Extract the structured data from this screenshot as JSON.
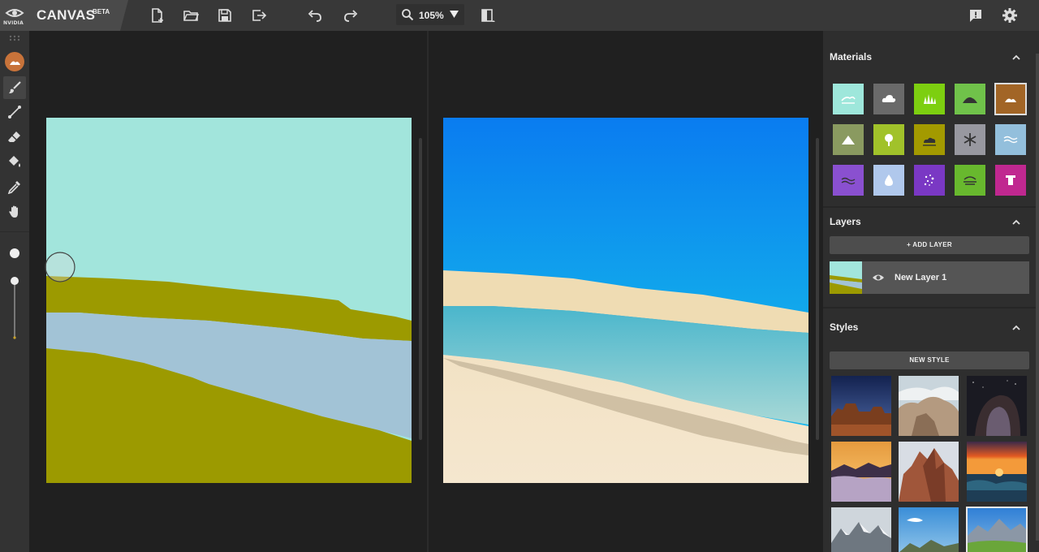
{
  "app": {
    "logo_word": "NVIDIA",
    "title": "CANVAS",
    "badge": "BETA"
  },
  "toolbar": {
    "buttons": [
      "new-file",
      "open-folder",
      "save",
      "export",
      "undo",
      "redo"
    ],
    "zoom_value": "105%",
    "right_buttons": [
      "feedback",
      "settings"
    ]
  },
  "tools": [
    "material-selector",
    "brush",
    "line",
    "eraser",
    "paint-bucket",
    "eyedropper",
    "pan-hand"
  ],
  "brush_size": {
    "level": 0.5
  },
  "sidebar": {
    "materials": {
      "title": "Materials",
      "items": [
        {
          "name": "sky",
          "color": "#9ee7db"
        },
        {
          "name": "cloud",
          "color": "#6a6a6a"
        },
        {
          "name": "grass",
          "color": "#7dcf10"
        },
        {
          "name": "hill",
          "color": "#70c24a"
        },
        {
          "name": "sand",
          "color": "#a26526",
          "selected": true
        },
        {
          "name": "mountain",
          "color": "#8a9a60"
        },
        {
          "name": "tree",
          "color": "#a1c22a"
        },
        {
          "name": "bush",
          "color": "#a39a00"
        },
        {
          "name": "snow",
          "color": "#9898a0"
        },
        {
          "name": "sea",
          "color": "#93bfdc"
        },
        {
          "name": "water",
          "color": "#8a50d0"
        },
        {
          "name": "fog",
          "color": "#b0c8ec"
        },
        {
          "name": "stars",
          "color": "#7a38c4"
        },
        {
          "name": "river",
          "color": "#68b82e"
        },
        {
          "name": "rock",
          "color": "#c02890"
        }
      ]
    },
    "layers": {
      "title": "Layers",
      "add_label": "+ ADD LAYER",
      "items": [
        {
          "name": "New Layer 1"
        }
      ]
    },
    "styles": {
      "title": "Styles",
      "new_label": "NEW STYLE",
      "thumbnails": [
        "desert-mesa-night",
        "rocky-arch-clouds",
        "rock-arch-milky-way",
        "sunset-over-mist",
        "red-mountain-peaks",
        "ocean-sunset",
        "snowy-mountains",
        "coastal-cliffs-blue-sky",
        "alpine-lake-meadow"
      ]
    }
  },
  "colors": {
    "segmentation_sky": "#a2e5dc",
    "segmentation_sand": "#9c9a00",
    "segmentation_water": "#a2c3d6",
    "accent_selected": "#c8733a"
  }
}
